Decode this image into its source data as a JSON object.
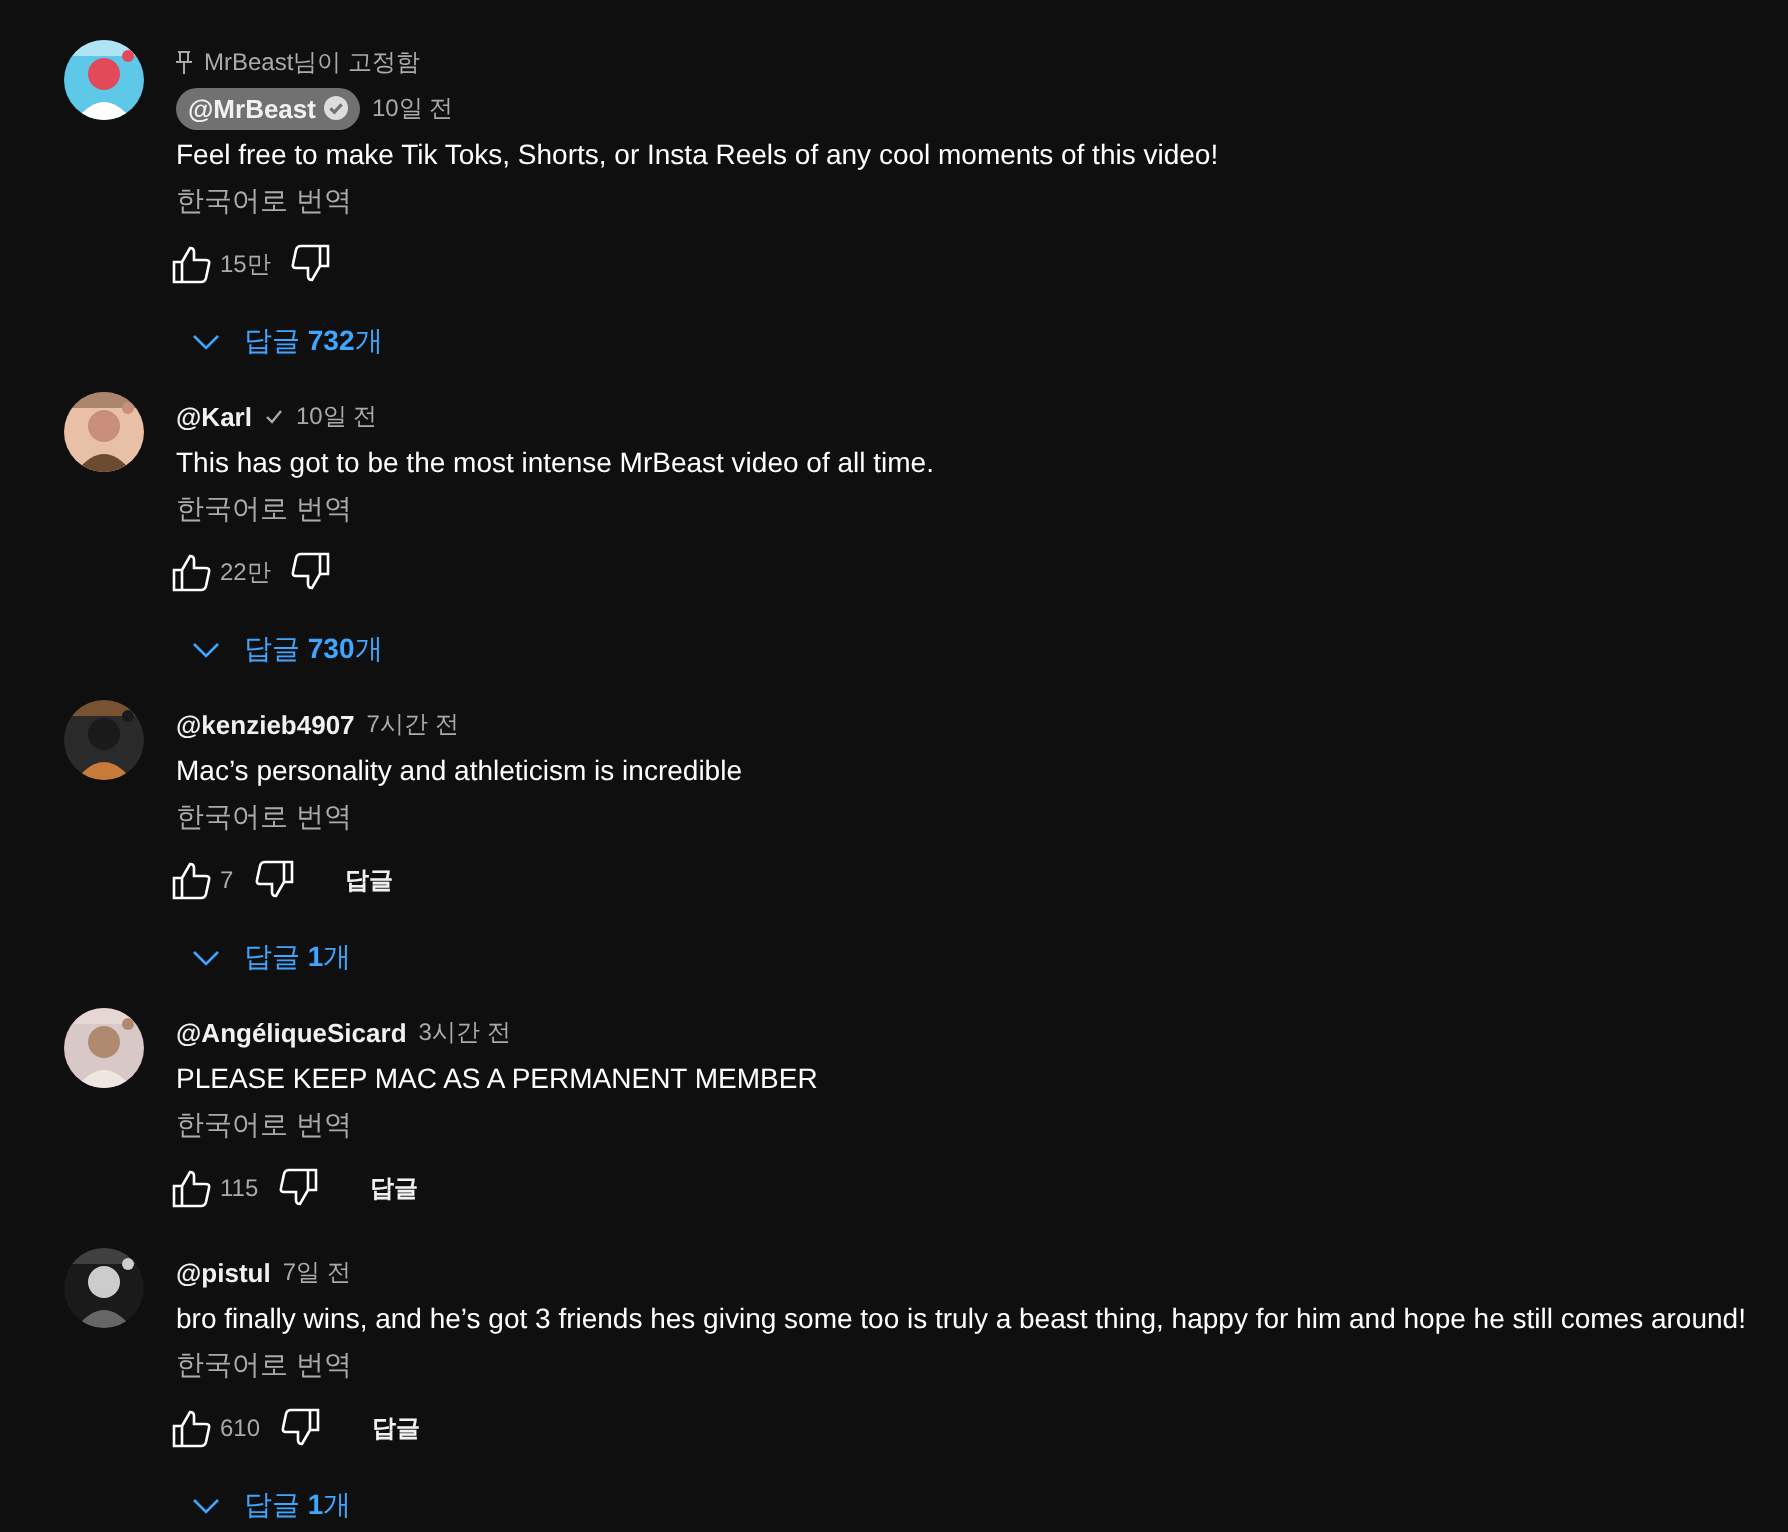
{
  "comments": [
    {
      "pinned": "MrBeast님이 고정함",
      "author": "@MrBeast",
      "highlighted": true,
      "verified": true,
      "time": "10일 전",
      "text": "Feel free to make Tik Toks, Shorts, or Insta Reels of any cool moments of this video!",
      "translate": "한국어로 번역",
      "likes": "15만",
      "replies": "답글 **732**개"
    },
    {
      "author": "@Karl",
      "highlighted": false,
      "verified": true,
      "time": "10일 전",
      "text": "This has got to be the most intense MrBeast video of all time.",
      "translate": "한국어로 번역",
      "likes": "22만",
      "replies": "답글 **730**개"
    },
    {
      "author": "@kenzieb4907",
      "highlighted": false,
      "verified": false,
      "time": "7시간 전",
      "text": "Mac’s personality and athleticism is incredible",
      "translate": "한국어로 번역",
      "likes": "7",
      "reply_button": "답글",
      "replies": "답글 **1**개"
    },
    {
      "author": "@AngéliqueSicard",
      "highlighted": false,
      "verified": false,
      "time": "3시간 전",
      "text": "PLEASE KEEP MAC AS A PERMANENT MEMBER",
      "translate": "한국어로 번역",
      "likes": "115",
      "reply_button": "답글"
    },
    {
      "author": "@pistul",
      "highlighted": false,
      "verified": false,
      "time": "7일 전",
      "text": "bro finally wins, and he’s got 3 friends hes giving some too is truly a beast thing, happy for him and hope he still comes around!",
      "translate": "한국어로 번역",
      "likes": "610",
      "reply_button": "답글",
      "replies": "답글 **1**개"
    }
  ]
}
